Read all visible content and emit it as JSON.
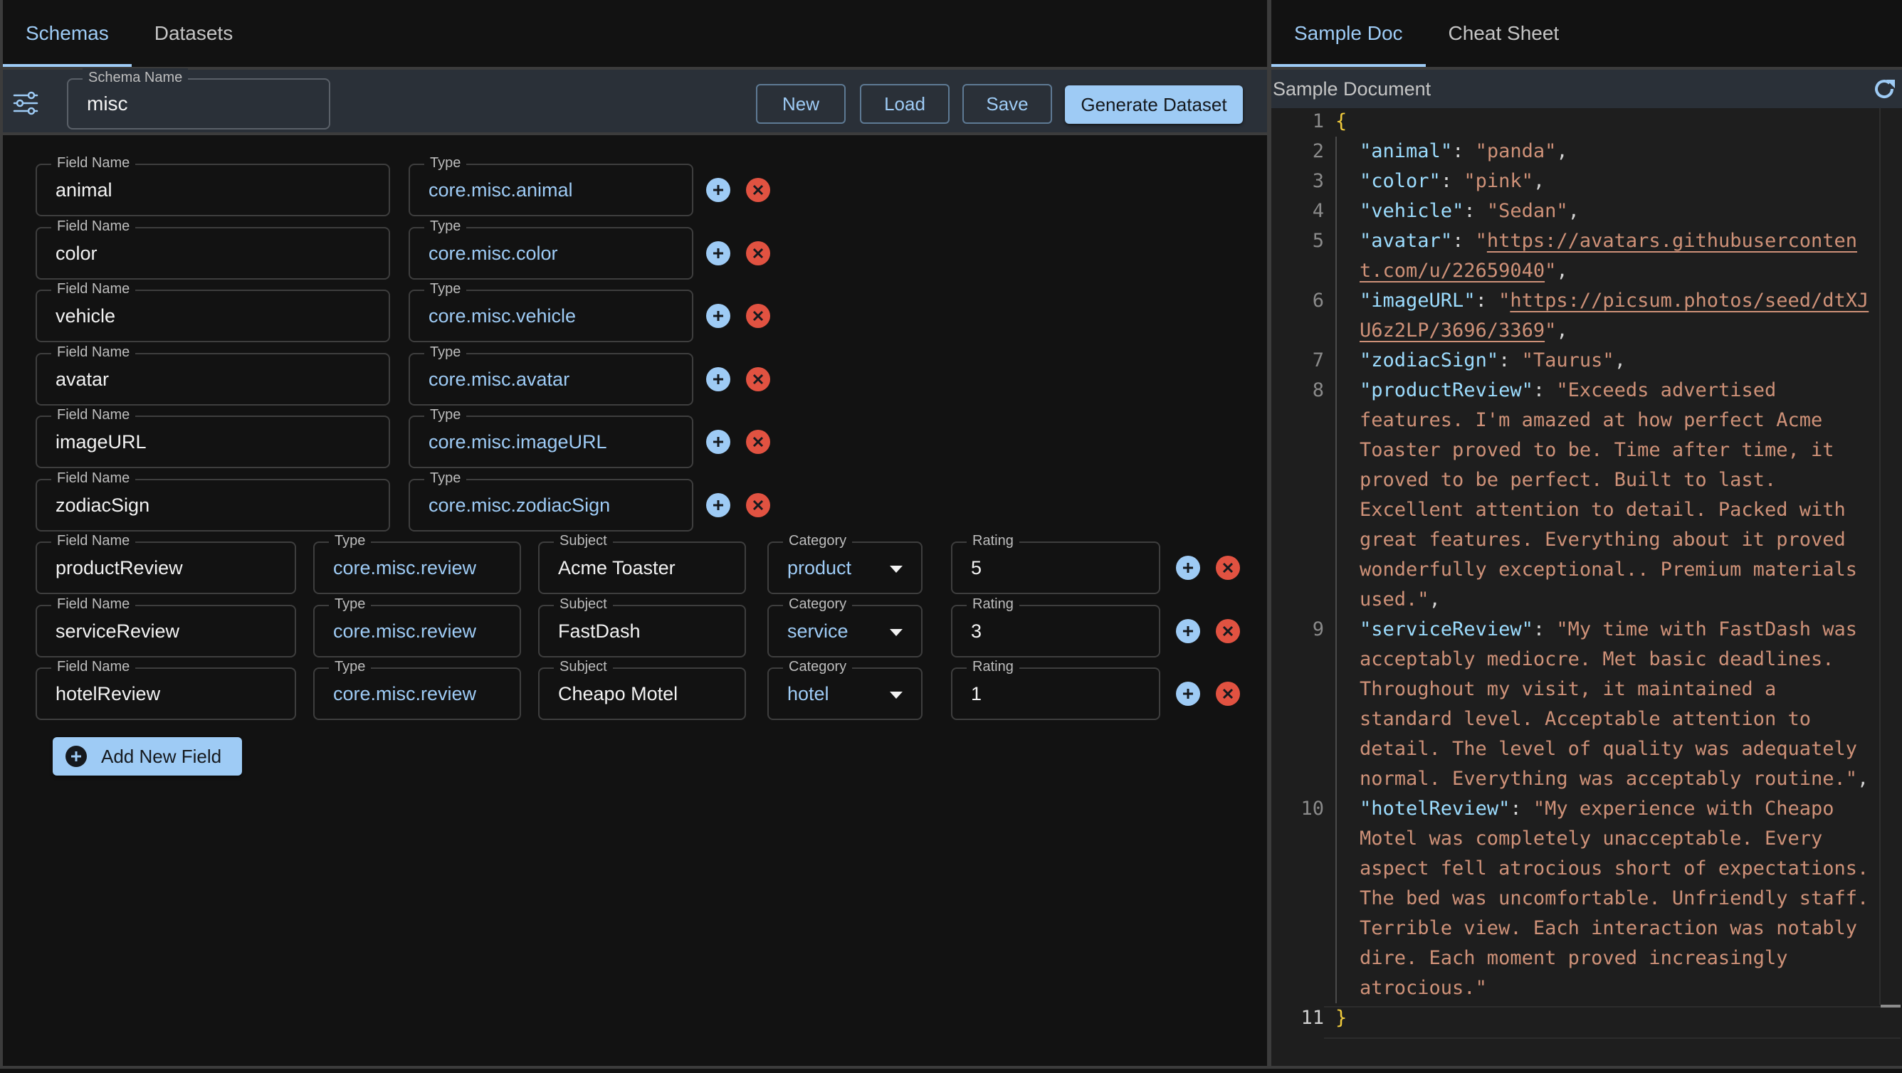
{
  "left_tabs": [
    {
      "label": "Schemas",
      "active": true
    },
    {
      "label": "Datasets",
      "active": false
    }
  ],
  "toolbar": {
    "schema_name_label": "Schema Name",
    "schema_name_value": "misc",
    "new_label": "New",
    "load_label": "Load",
    "save_label": "Save",
    "generate_label": "Generate Dataset"
  },
  "field_labels": {
    "field_name": "Field Name",
    "type": "Type",
    "subject": "Subject",
    "category": "Category",
    "rating": "Rating"
  },
  "simple_fields": [
    {
      "name": "animal",
      "type": "core.misc.animal"
    },
    {
      "name": "color",
      "type": "core.misc.color"
    },
    {
      "name": "vehicle",
      "type": "core.misc.vehicle"
    },
    {
      "name": "avatar",
      "type": "core.misc.avatar"
    },
    {
      "name": "imageURL",
      "type": "core.misc.imageURL"
    },
    {
      "name": "zodiacSign",
      "type": "core.misc.zodiacSign"
    }
  ],
  "review_fields": [
    {
      "name": "productReview",
      "type": "core.misc.review",
      "subject": "Acme Toaster",
      "category": "product",
      "rating": "5"
    },
    {
      "name": "serviceReview",
      "type": "core.misc.review",
      "subject": "FastDash",
      "category": "service",
      "rating": "3"
    },
    {
      "name": "hotelReview",
      "type": "core.misc.review",
      "subject": "Cheapo Motel",
      "category": "hotel",
      "rating": "1"
    }
  ],
  "add_field_label": "Add New Field",
  "right_tabs": [
    {
      "label": "Sample Doc",
      "active": true
    },
    {
      "label": "Cheat Sheet",
      "active": false
    }
  ],
  "sample_doc": {
    "title": "Sample Document",
    "line_numbers": [
      "1",
      "2",
      "3",
      "4",
      "5",
      "6",
      "7",
      "8",
      "9",
      "10",
      "11"
    ],
    "open_brace": "{",
    "close_brace": "}",
    "entries": [
      {
        "key": "animal",
        "value": "panda",
        "is_url": false
      },
      {
        "key": "color",
        "value": "pink",
        "is_url": false
      },
      {
        "key": "vehicle",
        "value": "Sedan",
        "is_url": false
      },
      {
        "key": "avatar",
        "value": "https://avatars.githubusercontent.com/u/22659040",
        "is_url": true
      },
      {
        "key": "imageURL",
        "value": "https://picsum.photos/seed/dtXJU6z2LP/3696/3369",
        "is_url": true
      },
      {
        "key": "zodiacSign",
        "value": "Taurus",
        "is_url": false
      },
      {
        "key": "productReview",
        "value": "Exceeds advertised features. I'm amazed at how perfect Acme Toaster proved to be. Time after time, it proved to be perfect. Built to last. Excellent attention to detail. Packed with great features. Everything about it proved wonderfully exceptional.. Premium materials used.",
        "is_url": false
      },
      {
        "key": "serviceReview",
        "value": "My time with FastDash was acceptably mediocre. Met basic deadlines. Throughout my visit, it maintained a standard level. Acceptable attention to detail. The level of quality was adequately normal. Everything was acceptably routine.",
        "is_url": false
      },
      {
        "key": "hotelReview",
        "value": "My experience with Cheapo Motel was completely unacceptable. Every aspect fell atrocious short of expectations. The bed was uncomfortable. Unfriendly staff. Terrible view. Each interaction was notably dire. Each moment proved increasingly atrocious.",
        "is_url": false
      }
    ]
  },
  "colors": {
    "accent": "#9ecbf5",
    "danger": "#e15241",
    "toolbar_bg": "#2a3038",
    "json_key": "#9cdcfe",
    "json_string": "#ce9178",
    "json_brace": "#f2cc3c"
  }
}
